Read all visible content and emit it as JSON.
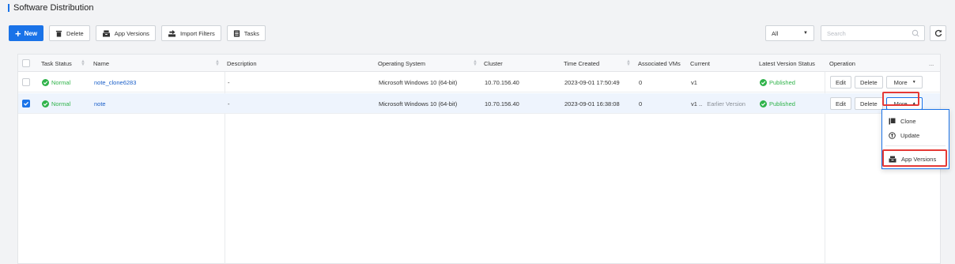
{
  "page": {
    "title": "Software Distribution"
  },
  "toolbar": {
    "new_label": "New",
    "delete_label": "Delete",
    "app_versions_label": "App Versions",
    "import_filters_label": "Import Filters",
    "tasks_label": "Tasks",
    "filter_value": "All",
    "search_placeholder": "Search"
  },
  "table": {
    "columns": {
      "task_status": "Task Status",
      "name": "Name",
      "description": "Description",
      "os": "Operating System",
      "cluster": "Cluster",
      "time_created": "Time Created",
      "associated_vms": "Associated VMs",
      "current": "Current",
      "latest_version_status": "Latest Version Status",
      "operation": "Operation",
      "more": "..."
    },
    "rows": [
      {
        "task_status": "Normal",
        "name": "note_clone6283",
        "description": "-",
        "os": "Microsoft Windows 10 (64-bit)",
        "cluster": "10.70.156.40",
        "time_created": "2023-09-01 17:50:49",
        "associated_vms": "0",
        "current": "v1",
        "current_note": "",
        "latest_version_status": "Published",
        "edit": "Edit",
        "delete": "Delete",
        "more": "More",
        "selected": false
      },
      {
        "task_status": "Normal",
        "name": "note",
        "description": "-",
        "os": "Microsoft Windows 10 (64-bit)",
        "cluster": "10.70.156.40",
        "time_created": "2023-09-01 16:38:08",
        "associated_vms": "0",
        "current": "v1 ..",
        "current_note": "Earlier Version",
        "latest_version_status": "Published",
        "edit": "Edit",
        "delete": "Delete",
        "more": "More",
        "selected": true
      }
    ]
  },
  "more_menu": {
    "items": [
      {
        "label": "Clone",
        "icon": "clone-icon"
      },
      {
        "label": "Update",
        "icon": "update-icon"
      },
      {
        "label": "App Versions",
        "icon": "app-versions-icon"
      }
    ]
  },
  "colors": {
    "accent": "#1a73e8",
    "success": "#2fb34a",
    "highlight": "#e53935",
    "link": "#1a5fc8"
  }
}
